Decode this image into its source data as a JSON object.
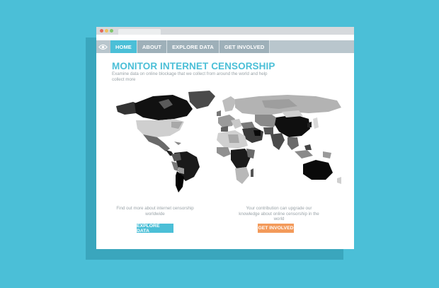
{
  "window": {
    "controls": [
      "close",
      "minimize",
      "maximize"
    ]
  },
  "nav": {
    "logo_icon": "eye-icon",
    "items": [
      {
        "label": "HOME",
        "active": true
      },
      {
        "label": "ABOUT",
        "active": false
      },
      {
        "label": "EXPLORE DATA",
        "active": false
      },
      {
        "label": "GET INVOLVED",
        "active": false
      }
    ]
  },
  "hero": {
    "title": "MONITOR INTERNET CENSORSHIP",
    "subtitle": "Examine data on online blockage that we collect from around the world and help collect more"
  },
  "map": {
    "icon": "world-map-icon"
  },
  "explore": {
    "text": "Find out more about internet censorship worldwide",
    "button": "EXPLORE DATA"
  },
  "involved": {
    "text": "Your contribution can upgrade our knowledge about online censorship in the world",
    "button": "GET INVOLVED"
  },
  "colors": {
    "background": "#4bbfd7",
    "accent": "#4bbfd7",
    "orange": "#f39a5a",
    "nav": "#b9c6cd"
  }
}
